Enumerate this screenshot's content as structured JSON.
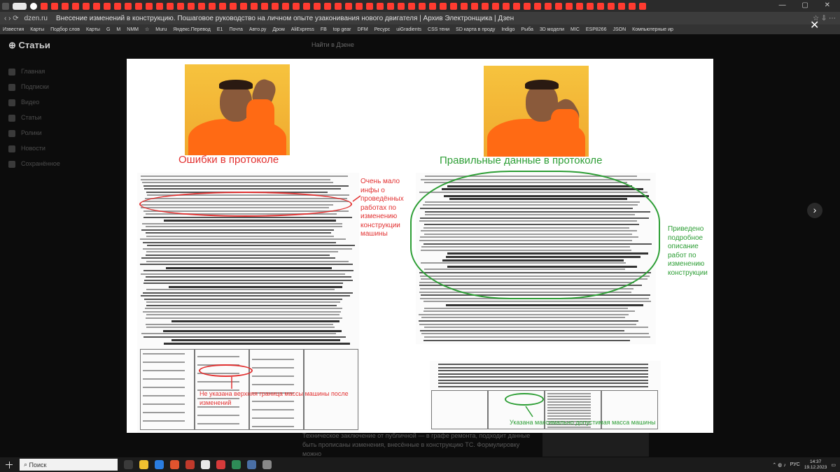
{
  "browser": {
    "url": "dzen.ru",
    "page_title": "Внесение изменений в конструкцию. Пошаговое руководство на личном опыте узаконивания нового двигателя | Архив Электронщика | Дзен",
    "bookmarks": [
      "Известия",
      "Карты",
      "Подбор слов",
      "Карты",
      "G",
      "M",
      "NMM",
      "☆",
      "Muru",
      "Яндекс.Перевод",
      "E1",
      "Почта",
      "Авто.ру",
      "Дром",
      "AliExpress",
      "FB",
      "top gear",
      "DFM",
      "Ресурс",
      "uiGradients",
      "CSS тени",
      "SD карта в проду",
      "Indigo",
      "Рыба",
      "3D модели",
      "MIC",
      "ESP8266",
      "JSON",
      "Компьютерные ир"
    ]
  },
  "site": {
    "logo": "Статьи",
    "search_placeholder": "Найти в Дзене",
    "menu": [
      "Главная",
      "Подписки",
      "Видео",
      "Статьи",
      "Ролики",
      "Новости",
      "Сохранённое"
    ],
    "underlay_text": "Техническое заключение от публичной — в графе ремонта, подходит данные быть прописаны изменения, внесённые в конструкцию ТС. Формулировку можно"
  },
  "viewer": {
    "close_icon": "close-icon",
    "next_icon": "chevron-right-icon",
    "caption_left": "Ошибки в протоколе",
    "caption_right": "Правильные данные в протоколе",
    "note_left": "Очень мало инфы о проведённых работах по изменению конструкции машины",
    "note_left_bottom": "Не указана верхняя граница массы машины после изменений",
    "note_right": "Приведено подробное описание работ по изменению конструкции",
    "note_right_bottom": "Указана максимально допустимая масса машины",
    "colors": {
      "red": "#e23131",
      "green": "#2d9e35",
      "jacket": "#ff6a14"
    }
  },
  "taskbar": {
    "search": "Поиск",
    "lang": "РУС",
    "time": "14:37",
    "date": "19.12.2023"
  }
}
